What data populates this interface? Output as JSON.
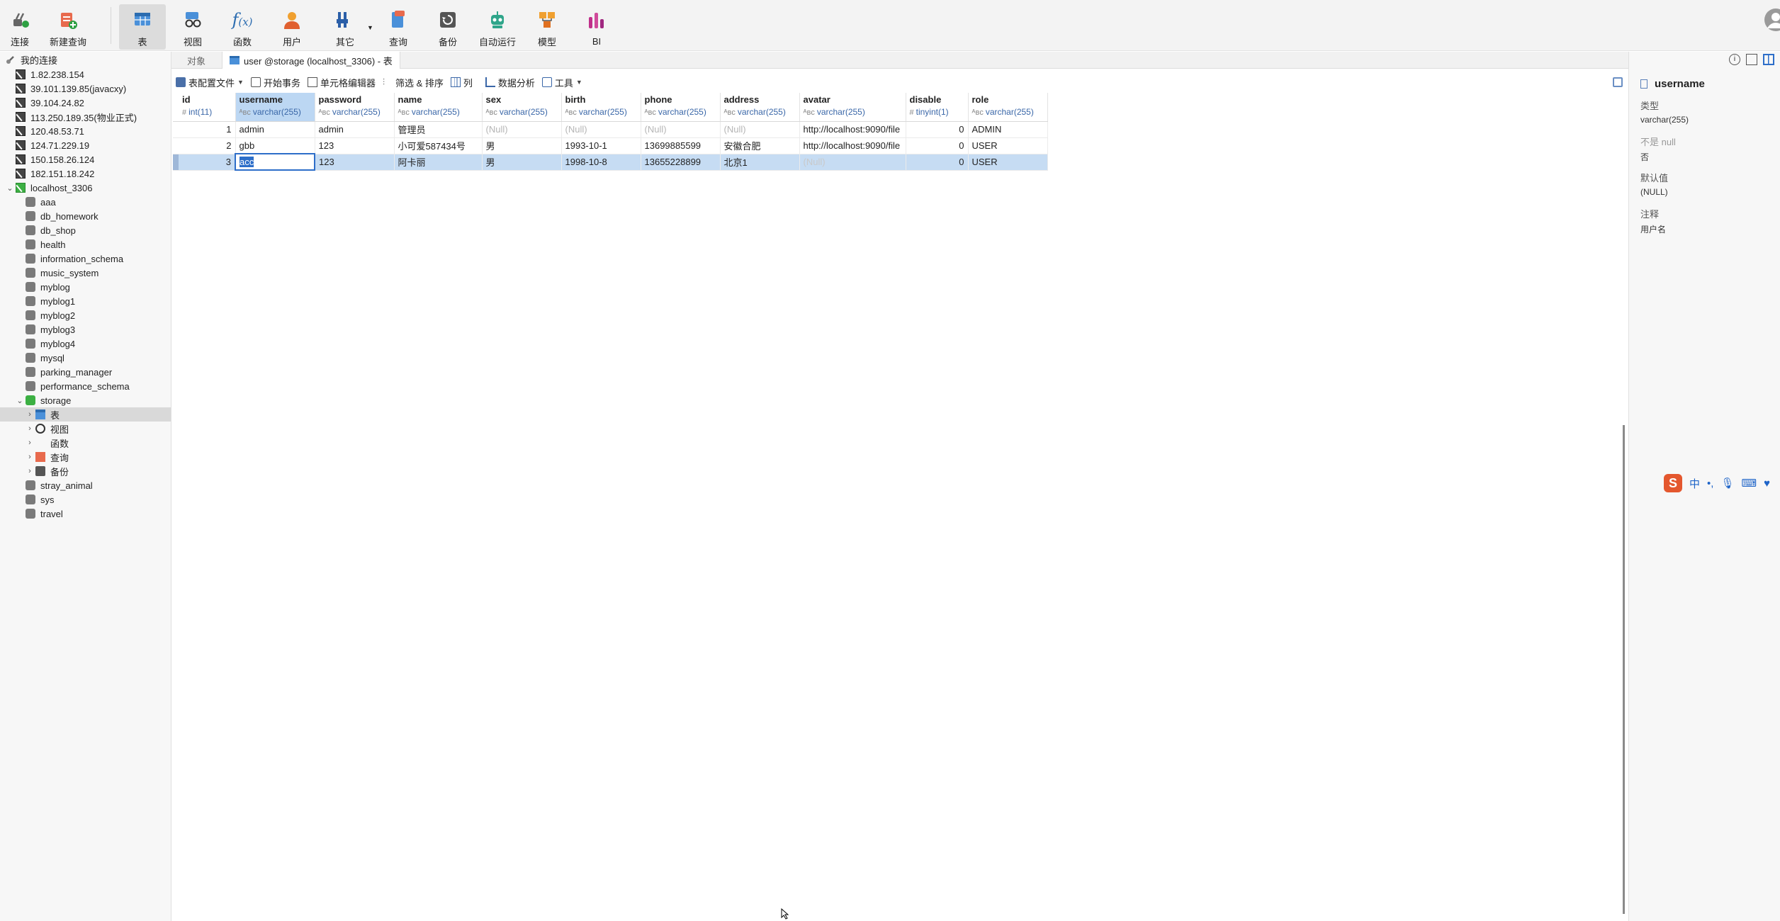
{
  "toolbar": {
    "connect": "连接",
    "new_query": "新建查询",
    "table": "表",
    "view": "视图",
    "function": "函数",
    "user": "用户",
    "other": "其它",
    "query": "查询",
    "backup": "备份",
    "auto_run": "自动运行",
    "model": "模型",
    "bi": "BI"
  },
  "sidebar": {
    "header": "我的连接",
    "connections": [
      "1.82.238.154",
      "39.101.139.85(javacxy)",
      "39.104.24.82",
      "113.250.189.35(物业正式)",
      "120.48.53.71",
      "124.71.229.19",
      "150.158.26.124",
      "182.151.18.242"
    ],
    "local_conn": "localhost_3306",
    "databases_before": [
      "aaa",
      "db_homework",
      "db_shop",
      "health",
      "information_schema",
      "music_system",
      "myblog",
      "myblog1",
      "myblog2",
      "myblog3",
      "myblog4",
      "mysql",
      "parking_manager",
      "performance_schema"
    ],
    "storage": "storage",
    "storage_children": [
      "表",
      "视图",
      "函数",
      "查询",
      "备份"
    ],
    "databases_after": [
      "stray_animal",
      "sys",
      "travel"
    ]
  },
  "tabs": {
    "objects": "对象",
    "active": "user @storage (localhost_3306) - 表"
  },
  "edit_toolbar": {
    "table_config": "表配置文件",
    "begin_tx": "开始事务",
    "cell_editor": "单元格编辑器",
    "filter_sort": "筛选 & 排序",
    "columns": "列",
    "data_analysis": "数据分析",
    "tools": "工具"
  },
  "grid": {
    "columns": [
      {
        "name": "id",
        "type": "int(11)"
      },
      {
        "name": "username",
        "type": "varchar(255)"
      },
      {
        "name": "password",
        "type": "varchar(255)"
      },
      {
        "name": "name",
        "type": "varchar(255)"
      },
      {
        "name": "sex",
        "type": "varchar(255)"
      },
      {
        "name": "birth",
        "type": "varchar(255)"
      },
      {
        "name": "phone",
        "type": "varchar(255)"
      },
      {
        "name": "address",
        "type": "varchar(255)"
      },
      {
        "name": "avatar",
        "type": "varchar(255)"
      },
      {
        "name": "disable",
        "type": "tinyint(1)"
      },
      {
        "name": "role",
        "type": "varchar(255)"
      }
    ],
    "rows": [
      [
        "1",
        "admin",
        "admin",
        "管理员",
        "(Null)",
        "(Null)",
        "(Null)",
        "(Null)",
        "http://localhost:9090/file",
        "0",
        "ADMIN"
      ],
      [
        "2",
        "gbb",
        "123",
        "小可爱587434号",
        "男",
        "1993-10-1",
        "13699885599",
        "安徽合肥",
        "http://localhost:9090/file",
        "0",
        "USER"
      ],
      [
        "3",
        "acc",
        "123",
        "阿卡丽",
        "男",
        "1998-10-8",
        "13655228899",
        "北京1",
        "(Null)",
        "0",
        "USER"
      ]
    ]
  },
  "inspector": {
    "field": "username",
    "type_label": "类型",
    "type_value": "varchar(255)",
    "notnull_label": "不是 null",
    "notnull_value": "否",
    "default_label": "默认值",
    "default_value": "(NULL)",
    "comment_label": "注释",
    "comment_value": "用户名"
  },
  "ime": {
    "zh": "中"
  },
  "colors": {
    "accent": "#2d6ec9",
    "selected_row": "#c6dcf3",
    "header_selected": "#bcd7f3",
    "connected": "#3cb043"
  }
}
